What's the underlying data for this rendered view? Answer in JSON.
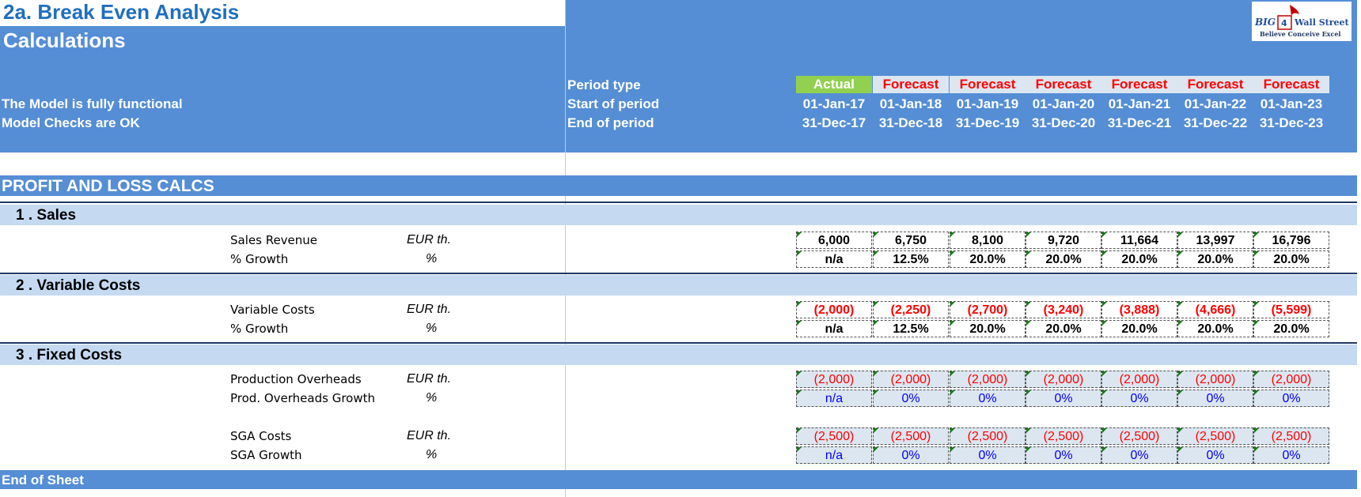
{
  "sheet_title": "2a. Break Even Analysis",
  "section_title": "Calculations",
  "status": [
    "The Model is fully functional",
    "Model Checks are OK"
  ],
  "header_labels": [
    "Period type",
    "Start of period",
    "End of period"
  ],
  "logo": {
    "left": "BIG",
    "middle": "4",
    "right": "Wall Street",
    "tagline": "Believe Conceive Excel"
  },
  "periods": [
    {
      "type": "Actual",
      "start": "01-Jan-17",
      "end": "31-Dec-17"
    },
    {
      "type": "Forecast",
      "start": "01-Jan-18",
      "end": "31-Dec-18"
    },
    {
      "type": "Forecast",
      "start": "01-Jan-19",
      "end": "31-Dec-19"
    },
    {
      "type": "Forecast",
      "start": "01-Jan-20",
      "end": "31-Dec-20"
    },
    {
      "type": "Forecast",
      "start": "01-Jan-21",
      "end": "31-Dec-21"
    },
    {
      "type": "Forecast",
      "start": "01-Jan-22",
      "end": "31-Dec-22"
    },
    {
      "type": "Forecast",
      "start": "01-Jan-23",
      "end": "31-Dec-23"
    }
  ],
  "pnl_title": "PROFIT AND LOSS CALCS",
  "sections": {
    "sales": "1 . Sales",
    "variable": "2 . Variable Costs",
    "fixed": "3 . Fixed Costs"
  },
  "rows": {
    "sales_revenue": {
      "label": "Sales Revenue",
      "unit": "EUR th.",
      "values": [
        "6,000",
        "6,750",
        "8,100",
        "9,720",
        "11,664",
        "13,997",
        "16,796"
      ]
    },
    "sales_growth": {
      "label": "% Growth",
      "unit": "%",
      "values": [
        "n/a",
        "12.5%",
        "20.0%",
        "20.0%",
        "20.0%",
        "20.0%",
        "20.0%"
      ]
    },
    "var_costs": {
      "label": "Variable Costs",
      "unit": "EUR th.",
      "values": [
        "(2,000)",
        "(2,250)",
        "(2,700)",
        "(3,240)",
        "(3,888)",
        "(4,666)",
        "(5,599)"
      ]
    },
    "var_growth": {
      "label": "% Growth",
      "unit": "%",
      "values": [
        "n/a",
        "12.5%",
        "20.0%",
        "20.0%",
        "20.0%",
        "20.0%",
        "20.0%"
      ]
    },
    "prod_overheads": {
      "label": "Production Overheads",
      "unit": "EUR th.",
      "values": [
        "(2,000)",
        "(2,000)",
        "(2,000)",
        "(2,000)",
        "(2,000)",
        "(2,000)",
        "(2,000)"
      ]
    },
    "prod_growth": {
      "label": "Prod. Overheads Growth",
      "unit": "%",
      "values": [
        "n/a",
        "0%",
        "0%",
        "0%",
        "0%",
        "0%",
        "0%"
      ]
    },
    "sga_costs": {
      "label": "SGA Costs",
      "unit": "EUR th.",
      "values": [
        "(2,500)",
        "(2,500)",
        "(2,500)",
        "(2,500)",
        "(2,500)",
        "(2,500)",
        "(2,500)"
      ]
    },
    "sga_growth": {
      "label": "SGA Growth",
      "unit": "%",
      "values": [
        "n/a",
        "0%",
        "0%",
        "0%",
        "0%",
        "0%",
        "0%"
      ]
    }
  },
  "end_label": "End of Sheet",
  "colors": {
    "header_blue": "#558ed5",
    "band_light": "#c5d9f1",
    "actual_green": "#92d050",
    "forecast_red": "#ff0000",
    "input_blue": "#0000ff"
  }
}
